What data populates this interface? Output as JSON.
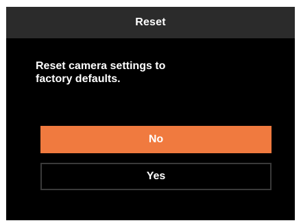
{
  "dialog": {
    "title": "Reset",
    "message": "Reset camera settings to\nfactory defaults.",
    "buttons": {
      "no_label": "No",
      "yes_label": "Yes"
    }
  },
  "colors": {
    "title_bar": "#2b2b2b",
    "background": "#000000",
    "accent": "#f07a3f",
    "text": "#ffffff"
  }
}
